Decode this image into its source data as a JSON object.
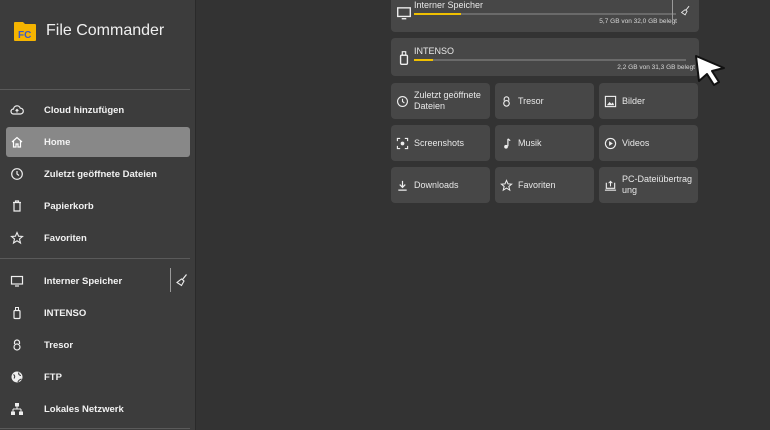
{
  "app": {
    "title": "File Commander"
  },
  "sidebar": {
    "items": [
      {
        "label": "Cloud hinzufügen",
        "icon": "cloud-upload-icon"
      },
      {
        "label": "Home",
        "icon": "home-icon",
        "active": true
      },
      {
        "label": "Zuletzt geöffnete Dateien",
        "icon": "clock-icon"
      },
      {
        "label": "Papierkorb",
        "icon": "trash-icon"
      },
      {
        "label": "Favoriten",
        "icon": "star-icon"
      },
      {
        "label": "Interner Speicher",
        "icon": "monitor-icon"
      },
      {
        "label": "INTENSO",
        "icon": "usb-drive-icon"
      },
      {
        "label": "Tresor",
        "icon": "vault-lock-icon"
      },
      {
        "label": "FTP",
        "icon": "globe-icon"
      },
      {
        "label": "Lokales Netzwerk",
        "icon": "network-icon"
      }
    ]
  },
  "main": {
    "storage": [
      {
        "name": "Interner Speicher",
        "usage": "5,7 GB von 32,0 GB belegt",
        "used_fraction": 0.178,
        "icon": "monitor-icon"
      },
      {
        "name": "INTENSO",
        "usage": "2,2 GB von 31,3 GB belegt",
        "used_fraction": 0.07,
        "icon": "usb-drive-icon"
      }
    ],
    "tiles": [
      {
        "label": "Zuletzt geöffnete Dateien",
        "icon": "clock-icon"
      },
      {
        "label": "Tresor",
        "icon": "vault-lock-icon"
      },
      {
        "label": "Bilder",
        "icon": "image-icon"
      },
      {
        "label": "Screenshots",
        "icon": "screenshot-icon"
      },
      {
        "label": "Musik",
        "icon": "music-note-icon"
      },
      {
        "label": "Videos",
        "icon": "play-circle-icon"
      },
      {
        "label": "Downloads",
        "icon": "download-icon"
      },
      {
        "label": "Favoriten",
        "icon": "star-icon"
      },
      {
        "label": "PC-Dateiübertragung",
        "icon": "pc-transfer-icon"
      }
    ]
  },
  "colors": {
    "accent": "#f0c000",
    "background": "#333333",
    "sidebar": "#3c3c3c",
    "card": "#474747",
    "active": "#888888"
  }
}
